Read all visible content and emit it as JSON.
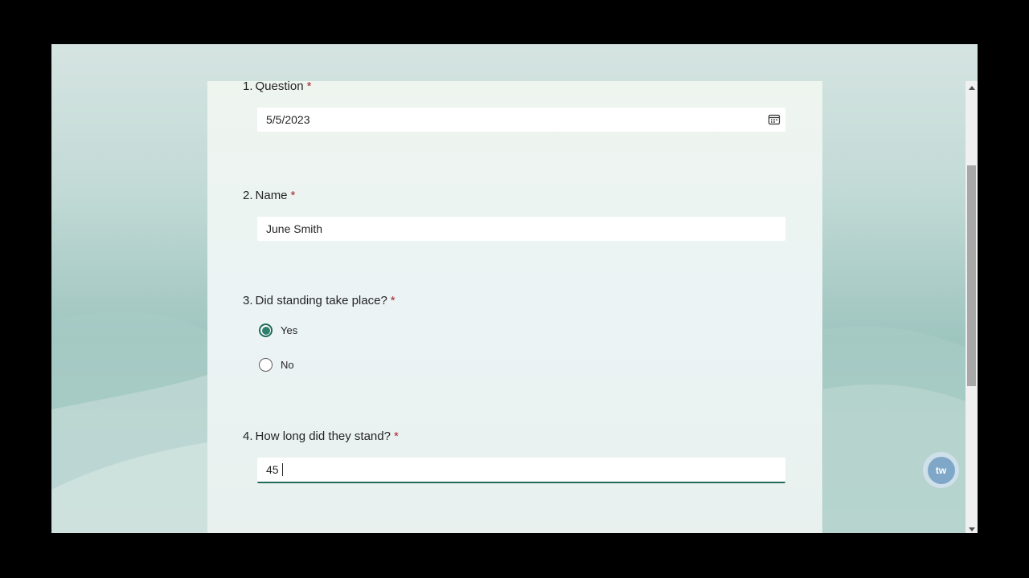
{
  "form": {
    "questions": [
      {
        "number": "1.",
        "title": "Question",
        "required_mark": "*",
        "value": "5/5/2023",
        "icon": "calendar-icon"
      },
      {
        "number": "2.",
        "title": "Name",
        "required_mark": "*",
        "value": "June Smith"
      },
      {
        "number": "3.",
        "title": "Did standing take place?",
        "required_mark": "*",
        "options": [
          "Yes",
          "No"
        ],
        "selected": "Yes"
      },
      {
        "number": "4.",
        "title": "How long did they stand?",
        "required_mark": "*",
        "value": "45"
      }
    ]
  },
  "badge": {
    "text": "tw",
    "icon": "chat-bot-icon"
  },
  "colors": {
    "accent": "#1f6a5b",
    "required": "#a4262c"
  }
}
